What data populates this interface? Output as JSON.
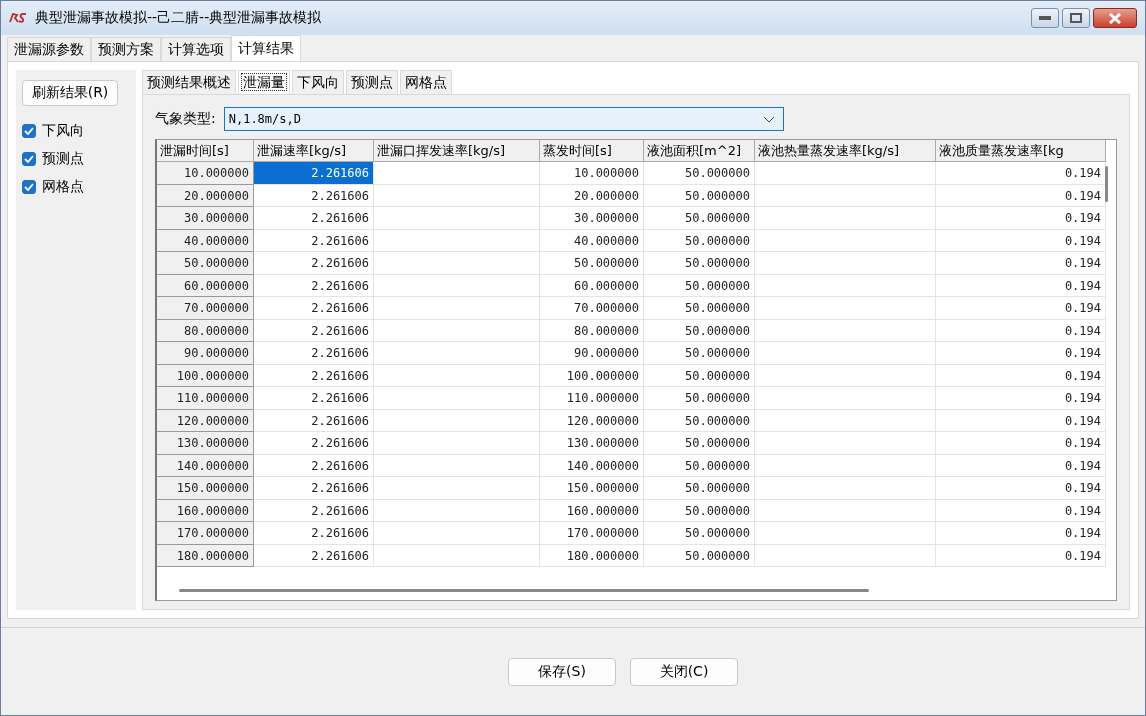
{
  "window": {
    "title": "典型泄漏事故模拟--己二腈--典型泄漏事故模拟"
  },
  "tabs": [
    {
      "label": "泄漏源参数",
      "selected": false
    },
    {
      "label": "预测方案",
      "selected": false
    },
    {
      "label": "计算选项",
      "selected": false
    },
    {
      "label": "计算结果",
      "selected": true
    }
  ],
  "refresh_button": "刷新结果(R)",
  "layers": [
    {
      "label": "下风向",
      "checked": true
    },
    {
      "label": "预测点",
      "checked": true
    },
    {
      "label": "网格点",
      "checked": true
    }
  ],
  "sub_tabs": [
    {
      "label": "预测结果概述",
      "selected": false
    },
    {
      "label": "泄漏量",
      "selected": true
    },
    {
      "label": "下风向",
      "selected": false
    },
    {
      "label": "预测点",
      "selected": false
    },
    {
      "label": "网格点",
      "selected": false
    }
  ],
  "weather": {
    "label": "气象类型:",
    "value": "N,1.8m/s,D"
  },
  "table": {
    "columns": [
      "泄漏时间[s]",
      "泄漏速率[kg/s]",
      "泄漏口挥发速率[kg/s]",
      "蒸发时间[s]",
      "液池面积[m^2]",
      "液池热量蒸发速率[kg/s]",
      "液池质量蒸发速率[kg"
    ],
    "rows": [
      {
        "leak_time": "10.000000",
        "leak_rate": "2.261606",
        "evap_time": "10.000000",
        "pool_area": "50.000000",
        "mass_rate": "0.194",
        "selected": true
      },
      {
        "leak_time": "20.000000",
        "leak_rate": "2.261606",
        "evap_time": "20.000000",
        "pool_area": "50.000000",
        "mass_rate": "0.194",
        "selected": false
      },
      {
        "leak_time": "30.000000",
        "leak_rate": "2.261606",
        "evap_time": "30.000000",
        "pool_area": "50.000000",
        "mass_rate": "0.194",
        "selected": false
      },
      {
        "leak_time": "40.000000",
        "leak_rate": "2.261606",
        "evap_time": "40.000000",
        "pool_area": "50.000000",
        "mass_rate": "0.194",
        "selected": false
      },
      {
        "leak_time": "50.000000",
        "leak_rate": "2.261606",
        "evap_time": "50.000000",
        "pool_area": "50.000000",
        "mass_rate": "0.194",
        "selected": false
      },
      {
        "leak_time": "60.000000",
        "leak_rate": "2.261606",
        "evap_time": "60.000000",
        "pool_area": "50.000000",
        "mass_rate": "0.194",
        "selected": false
      },
      {
        "leak_time": "70.000000",
        "leak_rate": "2.261606",
        "evap_time": "70.000000",
        "pool_area": "50.000000",
        "mass_rate": "0.194",
        "selected": false
      },
      {
        "leak_time": "80.000000",
        "leak_rate": "2.261606",
        "evap_time": "80.000000",
        "pool_area": "50.000000",
        "mass_rate": "0.194",
        "selected": false
      },
      {
        "leak_time": "90.000000",
        "leak_rate": "2.261606",
        "evap_time": "90.000000",
        "pool_area": "50.000000",
        "mass_rate": "0.194",
        "selected": false
      },
      {
        "leak_time": "100.000000",
        "leak_rate": "2.261606",
        "evap_time": "100.000000",
        "pool_area": "50.000000",
        "mass_rate": "0.194",
        "selected": false
      },
      {
        "leak_time": "110.000000",
        "leak_rate": "2.261606",
        "evap_time": "110.000000",
        "pool_area": "50.000000",
        "mass_rate": "0.194",
        "selected": false
      },
      {
        "leak_time": "120.000000",
        "leak_rate": "2.261606",
        "evap_time": "120.000000",
        "pool_area": "50.000000",
        "mass_rate": "0.194",
        "selected": false
      },
      {
        "leak_time": "130.000000",
        "leak_rate": "2.261606",
        "evap_time": "130.000000",
        "pool_area": "50.000000",
        "mass_rate": "0.194",
        "selected": false
      },
      {
        "leak_time": "140.000000",
        "leak_rate": "2.261606",
        "evap_time": "140.000000",
        "pool_area": "50.000000",
        "mass_rate": "0.194",
        "selected": false
      },
      {
        "leak_time": "150.000000",
        "leak_rate": "2.261606",
        "evap_time": "150.000000",
        "pool_area": "50.000000",
        "mass_rate": "0.194",
        "selected": false
      },
      {
        "leak_time": "160.000000",
        "leak_rate": "2.261606",
        "evap_time": "160.000000",
        "pool_area": "50.000000",
        "mass_rate": "0.194",
        "selected": false
      },
      {
        "leak_time": "170.000000",
        "leak_rate": "2.261606",
        "evap_time": "170.000000",
        "pool_area": "50.000000",
        "mass_rate": "0.194",
        "selected": false
      },
      {
        "leak_time": "180.000000",
        "leak_rate": "2.261606",
        "evap_time": "180.000000",
        "pool_area": "50.000000",
        "mass_rate": "0.194",
        "selected": false
      }
    ]
  },
  "buttons": [
    "保存(S)",
    "关闭(C)"
  ]
}
